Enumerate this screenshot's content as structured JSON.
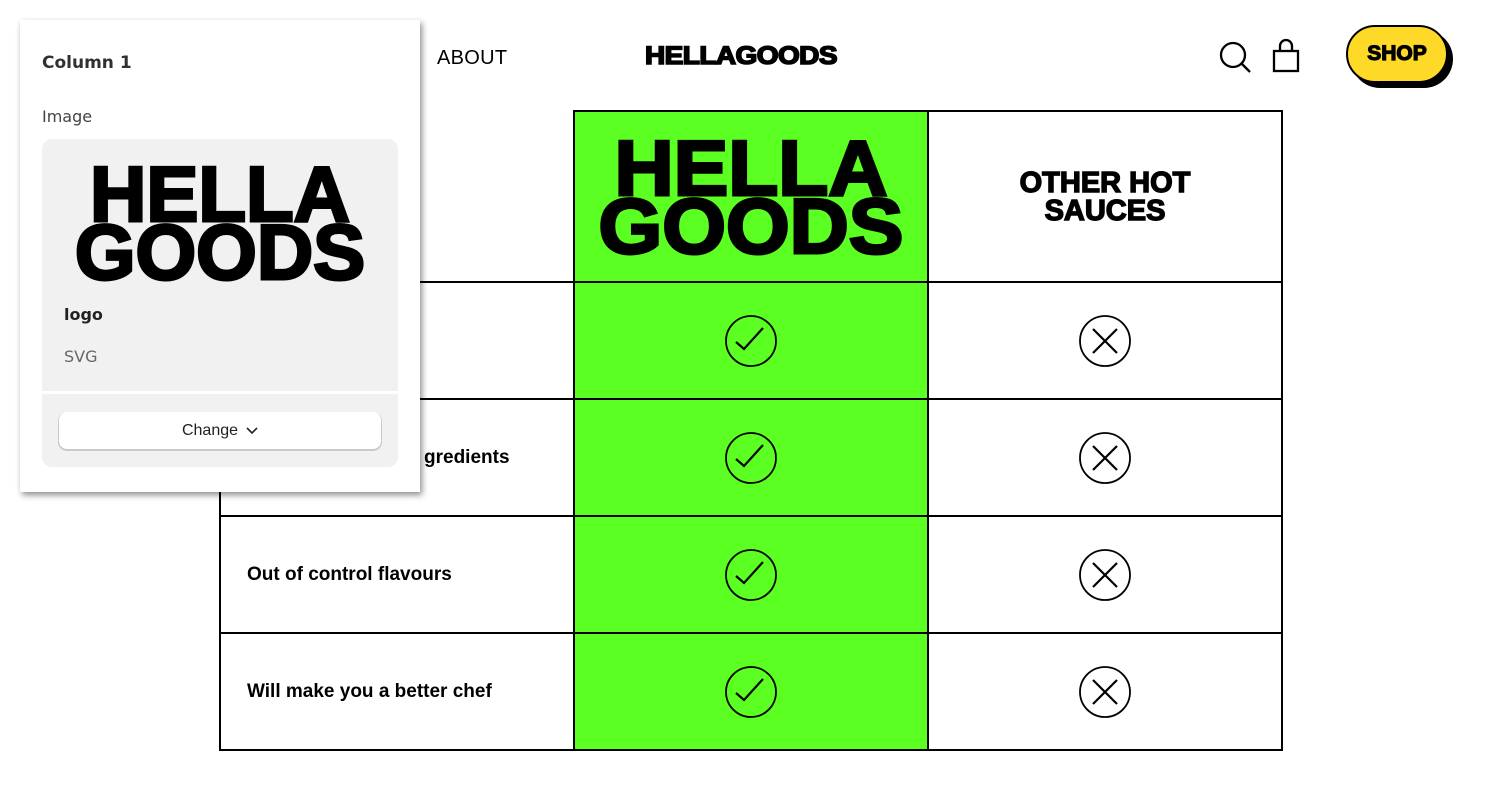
{
  "header": {
    "nav_about": "ABOUT",
    "brand": "HELLAGOODS",
    "shop_label": "SHOP",
    "shop_color": "#ffd927",
    "icons": [
      "search-icon",
      "bag-icon"
    ]
  },
  "table": {
    "brand_column": {
      "line1": "HELLA",
      "line2": "GOODS",
      "color": "#5cff22"
    },
    "other_column": {
      "line1": "OTHER HOT",
      "line2": "SAUCES"
    },
    "rows": [
      {
        "label": "",
        "brand": "check-icon",
        "other": "x-icon"
      },
      {
        "label": "gredients",
        "brand": "check-icon",
        "other": "x-icon"
      },
      {
        "label": "Out of control flavours",
        "brand": "check-icon",
        "other": "x-icon"
      },
      {
        "label": "Will make you a better chef",
        "brand": "check-icon",
        "other": "x-icon"
      }
    ]
  },
  "panel": {
    "title": "Column 1",
    "field_label": "Image",
    "thumb_line1": "HELLA",
    "thumb_line2": "GOODS",
    "file_name": "logo",
    "file_type": "SVG",
    "change_label": "Change"
  }
}
